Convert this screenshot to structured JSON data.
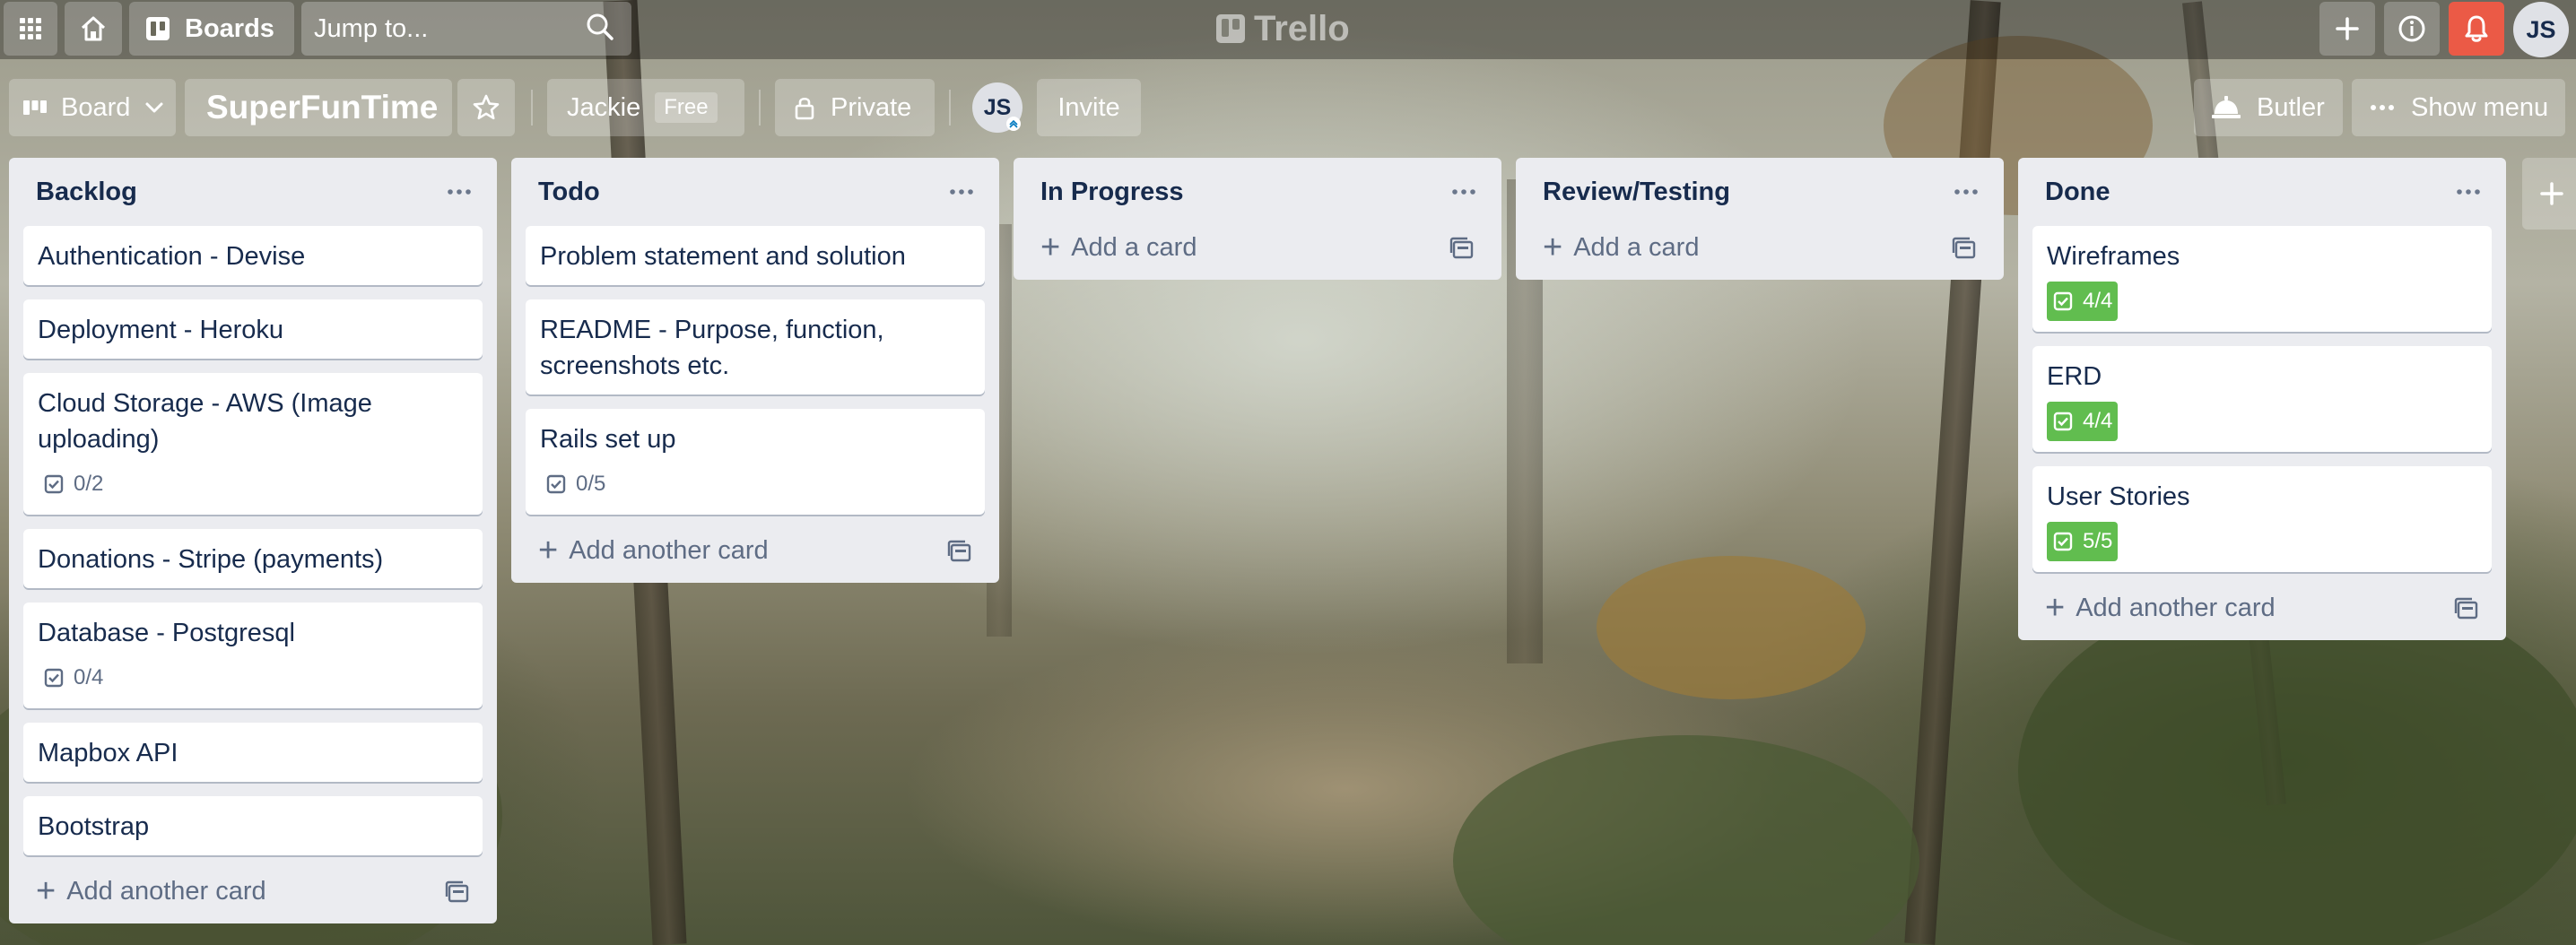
{
  "topbar": {
    "boards_label": "Boards",
    "search_placeholder": "Jump to...",
    "logo_text": "Trello",
    "avatar_initials": "JS"
  },
  "board_header": {
    "board_view_label": "Board",
    "title": "SuperFunTime",
    "workspace": "Jackie",
    "plan_badge": "Free",
    "visibility": "Private",
    "member_initials": "JS",
    "invite_label": "Invite",
    "butler_label": "Butler",
    "show_menu_label": "Show menu"
  },
  "lists": [
    {
      "title": "Backlog",
      "cards": [
        {
          "title": "Authentication - Devise",
          "checklist": ""
        },
        {
          "title": "Deployment - Heroku",
          "checklist": ""
        },
        {
          "title": "Cloud Storage - AWS (Image uploading)",
          "checklist": "0/2"
        },
        {
          "title": "Donations - Stripe (payments)",
          "checklist": ""
        },
        {
          "title": "Database - Postgresql",
          "checklist": "0/4"
        },
        {
          "title": "Mapbox API",
          "checklist": ""
        },
        {
          "title": "Bootstrap",
          "checklist": ""
        }
      ],
      "add_label": "Add another card"
    },
    {
      "title": "Todo",
      "cards": [
        {
          "title": "Problem statement and solution",
          "checklist": ""
        },
        {
          "title": "README - Purpose, function, screenshots etc.",
          "checklist": ""
        },
        {
          "title": "Rails set up",
          "checklist": "0/5"
        }
      ],
      "add_label": "Add another card"
    },
    {
      "title": "In Progress",
      "cards": [],
      "add_label": "Add a card"
    },
    {
      "title": "Review/Testing",
      "cards": [],
      "add_label": "Add a card"
    },
    {
      "title": "Done",
      "cards": [
        {
          "title": "Wireframes",
          "checklist": "4/4"
        },
        {
          "title": "ERD",
          "checklist": "4/4"
        },
        {
          "title": "User Stories",
          "checklist": "5/5"
        }
      ],
      "add_label": "Add another card"
    }
  ],
  "colors": {
    "list_bg": "#ebecf0",
    "text": "#172b4d",
    "muted": "#5e6c84",
    "complete_badge": "#61bd4f",
    "notification": "#eb5a46"
  }
}
